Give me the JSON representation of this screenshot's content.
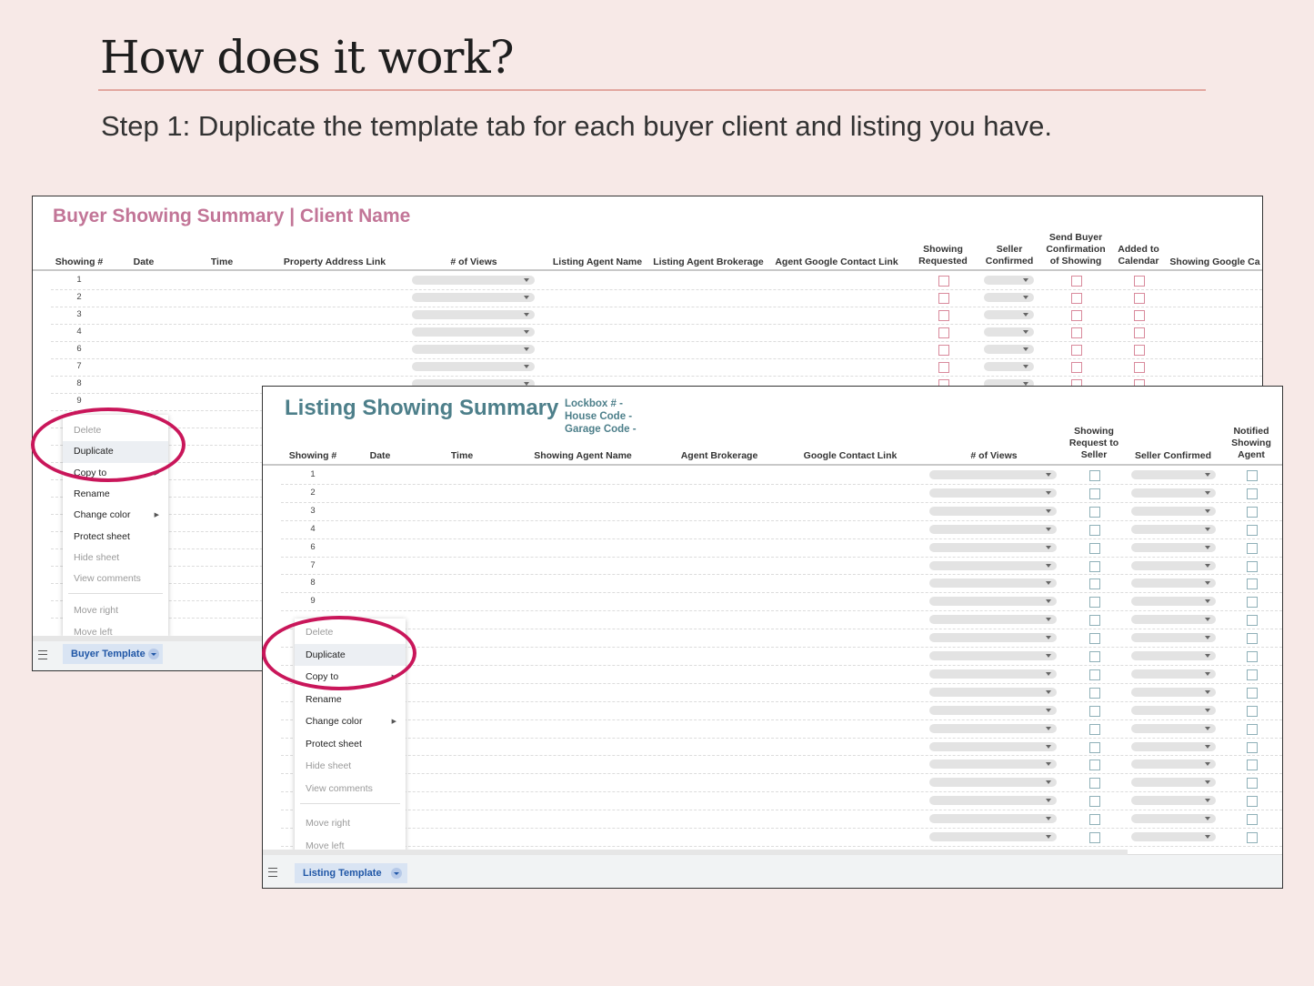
{
  "page": {
    "heading": "How does it work?",
    "step_text": "Step 1: Duplicate the template tab for each buyer client and listing you have.",
    "colors": {
      "background": "#f7e9e7",
      "rule": "#e3a7a0",
      "buyer_accent": "#c27597",
      "listing_accent": "#4d7f8a",
      "callout": "#c9165a",
      "tab_text": "#1f56a6"
    }
  },
  "buyer_sheet": {
    "title": "Buyer Showing Summary | Client Name",
    "columns": [
      "Showing #",
      "Date",
      "Time",
      "Property Address Link",
      "# of Views",
      "Listing Agent Name",
      "Listing Agent Brokerage",
      "Agent Google Contact Link",
      "Showing\nRequested",
      "Seller\nConfirmed",
      "Send Buyer\nConfirmation\nof Showing",
      "Added to\nCalendar",
      "Showing Google Ca"
    ],
    "row_numbers": [
      "1",
      "2",
      "3",
      "4",
      "6",
      "7",
      "8",
      "9"
    ],
    "tab_label": "Buyer Template",
    "context_menu": [
      {
        "label": "Delete",
        "enabled": false
      },
      {
        "label": "Duplicate",
        "enabled": true,
        "highlighted": true
      },
      {
        "label": "Copy to",
        "enabled": true,
        "submenu": true
      },
      {
        "label": "Rename",
        "enabled": true
      },
      {
        "label": "Change color",
        "enabled": true,
        "submenu": true
      },
      {
        "label": "Protect sheet",
        "enabled": true
      },
      {
        "label": "Hide sheet",
        "enabled": false
      },
      {
        "label": "View comments",
        "enabled": false
      },
      {
        "separator": true
      },
      {
        "label": "Move right",
        "enabled": false
      },
      {
        "label": "Move left",
        "enabled": false
      }
    ]
  },
  "listing_sheet": {
    "title": "Listing Showing Summary",
    "codes": [
      "Lockbox # -",
      "House Code -",
      "Garage Code -"
    ],
    "columns": [
      "Showing #",
      "Date",
      "Time",
      "Showing Agent Name",
      "Agent Brokerage",
      "Google Contact Link",
      "# of Views",
      "Showing\nRequest to\nSeller",
      "Seller Confirmed",
      "Notified\nShowing\nAgent"
    ],
    "row_numbers": [
      "1",
      "2",
      "3",
      "4",
      "6",
      "7",
      "8",
      "9"
    ],
    "tab_label": "Listing Template",
    "context_menu": [
      {
        "label": "Delete",
        "enabled": false
      },
      {
        "label": "Duplicate",
        "enabled": true,
        "highlighted": true
      },
      {
        "label": "Copy to",
        "enabled": true,
        "submenu": true
      },
      {
        "label": "Rename",
        "enabled": true
      },
      {
        "label": "Change color",
        "enabled": true,
        "submenu": true
      },
      {
        "label": "Protect sheet",
        "enabled": true
      },
      {
        "label": "Hide sheet",
        "enabled": false
      },
      {
        "label": "View comments",
        "enabled": false
      },
      {
        "separator": true
      },
      {
        "label": "Move right",
        "enabled": false
      },
      {
        "label": "Move left",
        "enabled": false
      }
    ]
  }
}
